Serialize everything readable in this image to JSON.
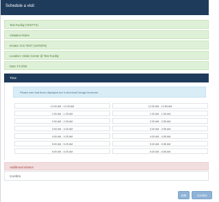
{
  "dialog": {
    "title": "Schedule a visit"
  },
  "summary": {
    "facility": "Test Facility (TESTTX)",
    "rules": "Visitation Rules",
    "inmate": "Inmate: ICS TEST (4278375)",
    "location": "Location: Visitor Center @ Test Facility",
    "date": "Date: Fri 8/26"
  },
  "time_section": {
    "title": "Time",
    "note": "Please note that times displayed are in America/Chicago timezone.",
    "slots_left": [
      "12:00 AM - 12:25 AM",
      "1:00 AM - 1:25 AM",
      "2:00 AM - 2:25 AM",
      "3:00 AM - 3:25 AM",
      "4:00 AM - 4:25 AM",
      "5:00 AM - 5:25 AM",
      "6:00 AM - 6:25 AM"
    ],
    "slots_right": [
      "12:30 AM - 12:55 AM",
      "1:30 AM - 1:55 AM",
      "2:30 AM - 2:55 AM",
      "3:30 AM - 3:55 AM",
      "4:30 AM - 4:55 AM",
      "5:30 AM - 5:55 AM",
      "6:30 AM - 6:55 AM"
    ]
  },
  "sections": {
    "additional_visitors": "Additional visitors",
    "confirm": "Confirm"
  },
  "footer": {
    "edit_label": "Edit",
    "confirm_label": "Confirm"
  }
}
